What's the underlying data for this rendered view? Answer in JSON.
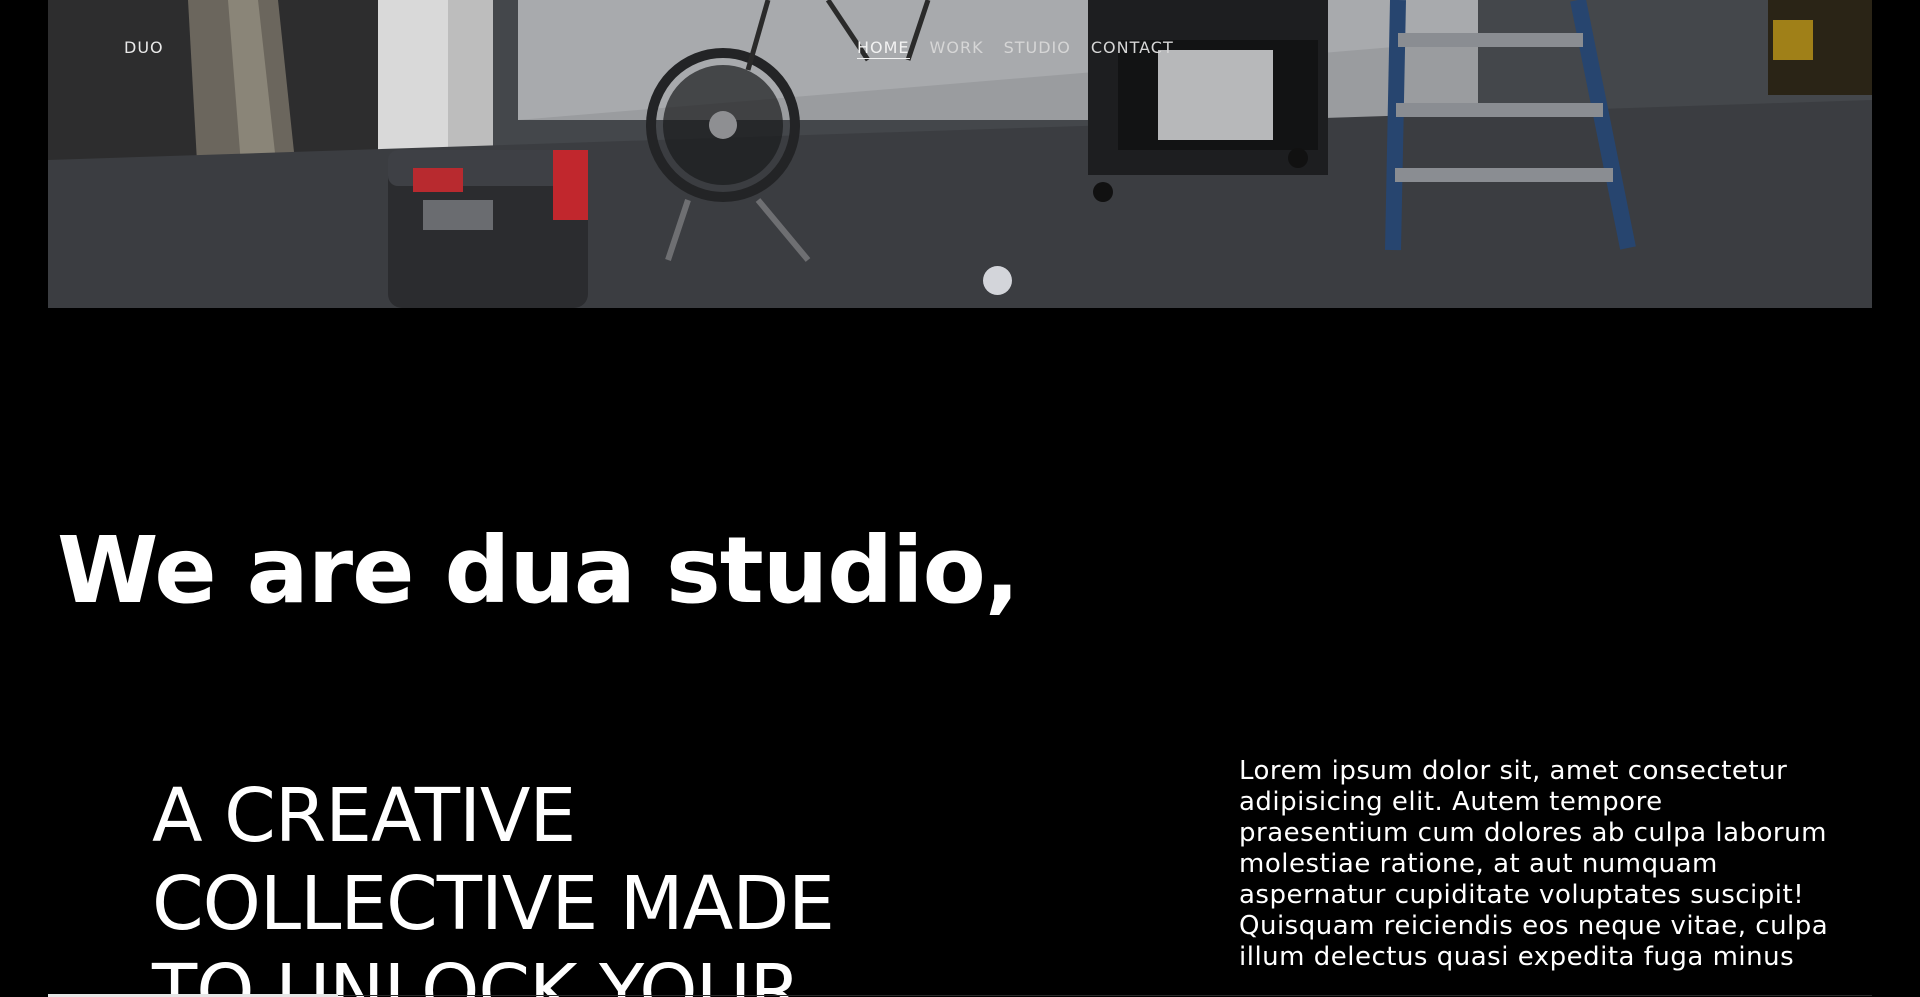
{
  "nav": {
    "logo": "DUO",
    "links": [
      {
        "label": "HOME",
        "active": true
      },
      {
        "label": "WORK",
        "active": false
      },
      {
        "label": "STUDIO",
        "active": false
      },
      {
        "label": "CONTACT",
        "active": false
      }
    ]
  },
  "hero": {
    "slide_index": 1,
    "slide_count": 1
  },
  "intro": {
    "headline": "We are dua studio,",
    "tagline": "A CREATIVE COLLECTIVE MADE TO UNLOCK YOUR",
    "body": "Lorem ipsum dolor sit, amet consectetur adipisicing elit. Autem tempore praesentium cum dolores ab culpa laborum molestiae ratione, at aut numquam aspernatur cupiditate voluptates suscipit! Quisquam reiciendis eos neque vitae, culpa illum delectus quasi expedita fuga minus"
  },
  "colors": {
    "background": "#000000",
    "text": "#ffffff",
    "slider_dot": "#d3d5da"
  }
}
